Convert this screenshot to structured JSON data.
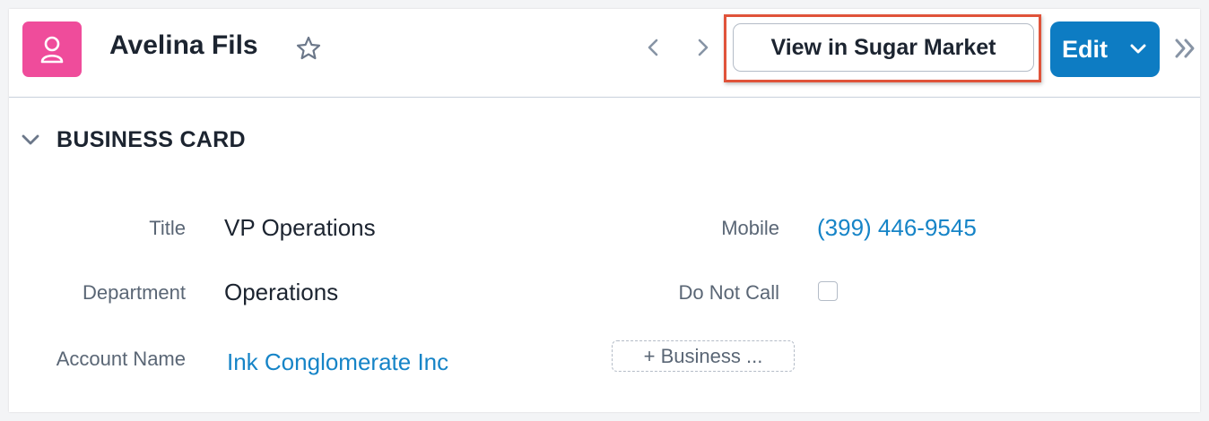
{
  "record": {
    "name": "Avelina Fils",
    "avatar_icon": "user-icon",
    "avatar_color": "#ef4c9b"
  },
  "header_actions": {
    "view_in_market_label": "View in Sugar Market",
    "edit_label": "Edit",
    "accent_color": "#0d7cc3",
    "highlight_color": "#e0533a"
  },
  "section": {
    "title": "BUSINESS CARD"
  },
  "fields": {
    "title": {
      "label": "Title",
      "value": "VP Operations"
    },
    "department": {
      "label": "Department",
      "value": "Operations"
    },
    "account_name": {
      "label": "Account Name",
      "value": "Ink Conglomerate Inc"
    },
    "mobile": {
      "label": "Mobile",
      "value": "(399) 446-9545"
    },
    "do_not_call": {
      "label": "Do Not Call",
      "checked": false
    }
  },
  "add_field_button": {
    "label": "+ Business ..."
  },
  "icons": [
    "user-icon",
    "star-icon",
    "prev-arrow-icon",
    "next-arrow-icon",
    "chevron-down-icon",
    "double-chevron-right-icon",
    "section-chevron-icon"
  ]
}
